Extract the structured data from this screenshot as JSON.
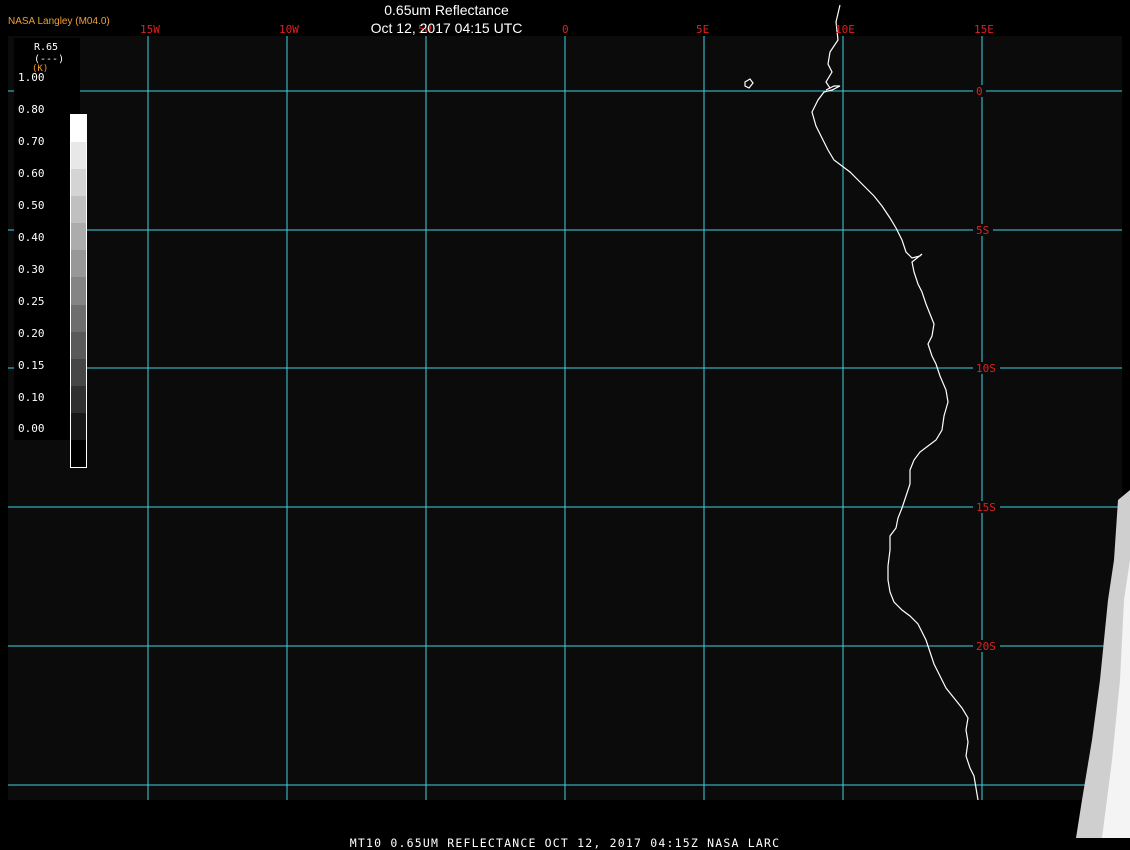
{
  "header": {
    "title": "0.65um Reflectance",
    "subtitle": "Oct 12, 2017 04:15 UTC",
    "org": "NASA Langley (M04.0)"
  },
  "footer": {
    "text": "MT10  0.65UM REFLECTANCE   OCT 12, 2017 04:15Z   NASA LARC"
  },
  "legend": {
    "variable": "R.65",
    "units": "(---)",
    "scale": "(K)",
    "ticks": [
      "1.00",
      "0.80",
      "0.70",
      "0.60",
      "0.50",
      "0.40",
      "0.30",
      "0.25",
      "0.20",
      "0.15",
      "0.10",
      "0.00"
    ],
    "ramp": [
      "#ffffff",
      "#e8e8e8",
      "#d4d4d4",
      "#c0c0c0",
      "#acacac",
      "#989898",
      "#848484",
      "#6e6e6e",
      "#5a5a5a",
      "#464646",
      "#303030",
      "#181818",
      "#000000"
    ]
  },
  "map": {
    "background": "#0b0b0b",
    "grid_color": "#40d0e0",
    "label_color": "#e02020",
    "coast_color": "#ffffff",
    "lon_labels": [
      "15W",
      "10W",
      "5W",
      "0",
      "5E",
      "10E",
      "15E"
    ],
    "lat_labels": [
      "0",
      "5S",
      "10S",
      "15S",
      "20S"
    ]
  }
}
